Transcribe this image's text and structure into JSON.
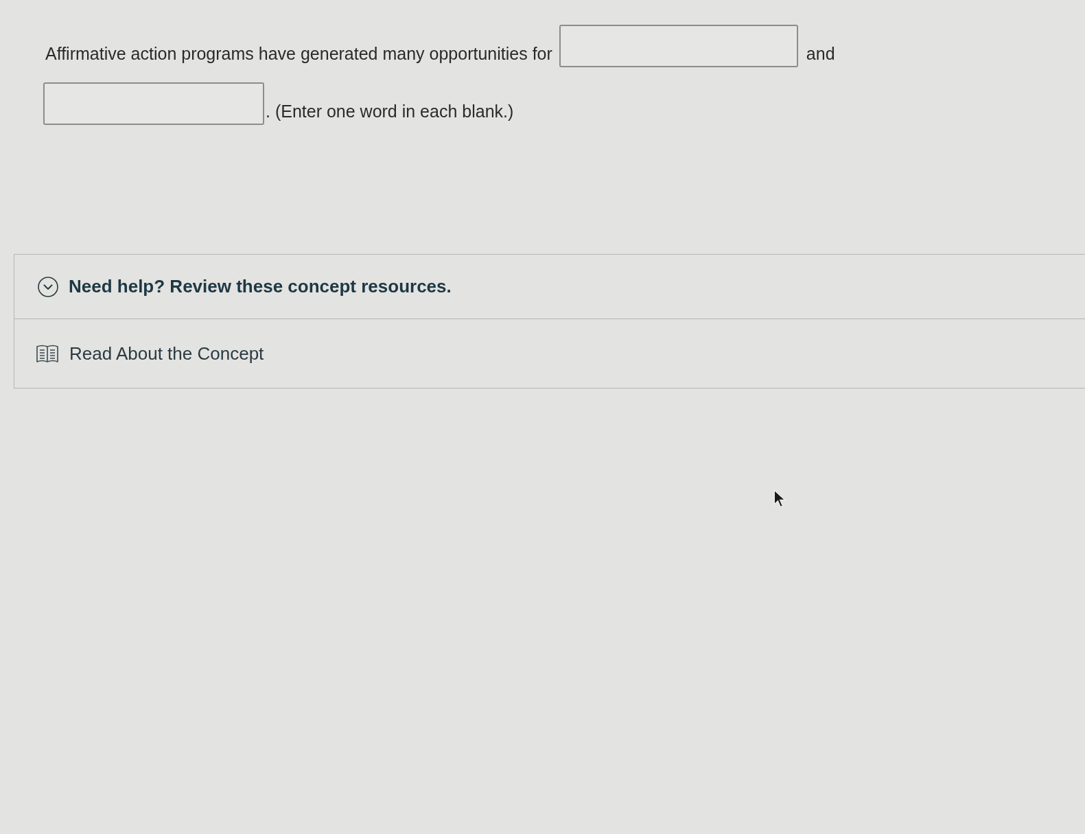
{
  "question": {
    "parts": [
      {
        "kind": "text",
        "text": "Affirmative action programs have generated many opportunities for"
      },
      {
        "kind": "blank"
      },
      {
        "kind": "text",
        "text": "and"
      },
      {
        "kind": "blank"
      },
      {
        "kind": "text",
        "text": ". (Enter one word in each blank.)"
      }
    ]
  },
  "help": {
    "title": "Need help? Review these concept resources.",
    "expanded": true,
    "resources": [
      {
        "label": "Read About the Concept"
      }
    ]
  }
}
